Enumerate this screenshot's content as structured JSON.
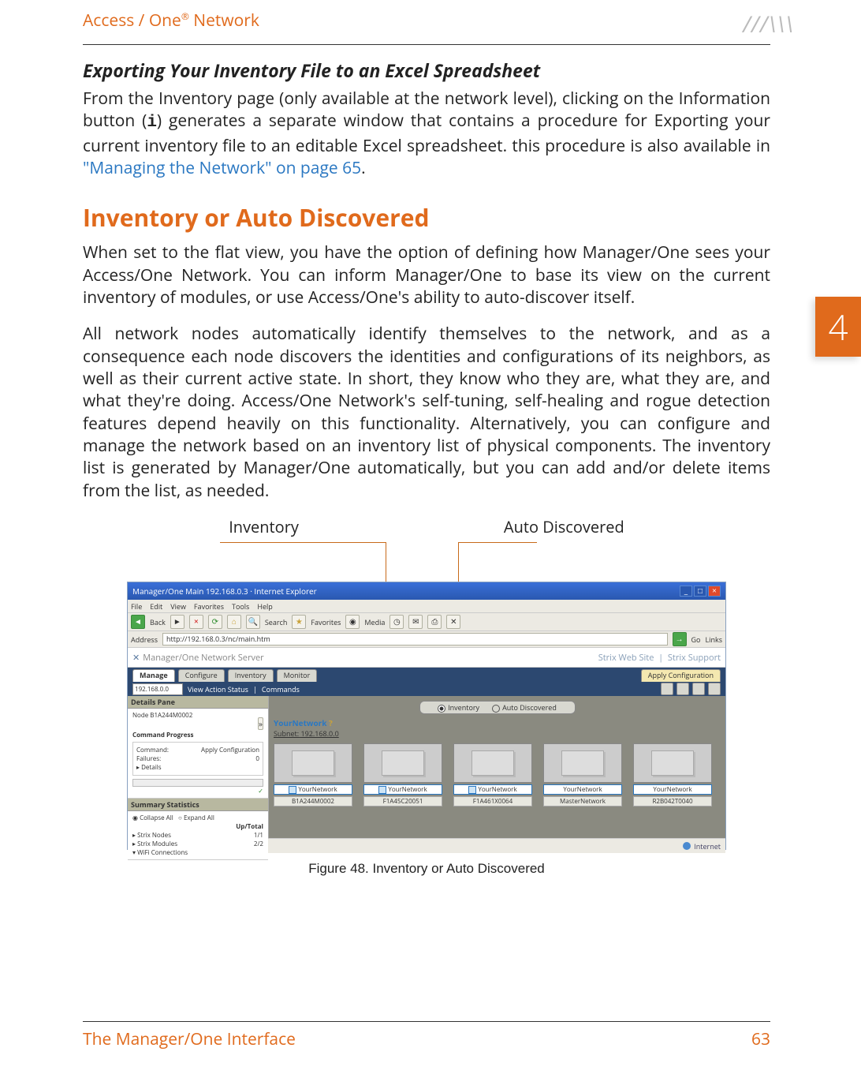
{
  "header": {
    "product": "Access / One",
    "reg": "®",
    "suffix": " Network",
    "logo": "///\\\\\\"
  },
  "side_tab": "4",
  "subsection": {
    "title": "Exporting Your Inventory File to an Excel Spreadsheet",
    "p1a": "From the Inventory page (only available at the network level), clicking on the Information button (",
    "p1_mono": "i",
    "p1b": ") generates a separate window that contains a procedure for Exporting your current inventory file to an editable Excel spreadsheet. this procedure is also available in ",
    "p1_link": "\"Managing the Network\" on page 65",
    "p1c": "."
  },
  "section": {
    "title": "Inventory or Auto Discovered",
    "p1": "When set to the flat view, you have the option of defining how Manager/One sees your Access/One Network. You can inform Manager/One to base its view on the current inventory of modules, or use Access/One's ability to auto-discover itself.",
    "p2": "All network nodes automatically identify themselves to the network, and as a consequence each node discovers the identities and configurations of its neighbors, as well as their current active state. In short, they know who they are, what they are, and what they're doing. Access/One Network's self-tuning, self-healing and rogue detection features depend heavily on this functionality. Alternatively, you can configure and manage the network based on an inventory list of physical components. The inventory list is generated by Manager/One automatically, but you can add and/or delete items from the list, as needed."
  },
  "callouts": {
    "left": "Inventory",
    "right": "Auto Discovered"
  },
  "screenshot": {
    "window_title": "Manager/One Main 192.168.0.3 · Internet Explorer",
    "menubar": [
      "File",
      "Edit",
      "View",
      "Favorites",
      "Tools",
      "Help"
    ],
    "toolbar": {
      "back": "Back",
      "search": "Search",
      "favorites": "Favorites",
      "media": "Media"
    },
    "addressbar": {
      "label": "Address",
      "url": "http://192.168.0.3/nc/main.htm",
      "go": "Go",
      "links": "Links"
    },
    "brandbar": {
      "title": "Manager/One Network Server",
      "link1": "Strix Web Site",
      "link2": "Strix Support"
    },
    "tabs": [
      "Manage",
      "Configure",
      "Inventory",
      "Monitor"
    ],
    "apply_btn": "Apply Configuration",
    "actionbar": {
      "ip": "192.168.0.0",
      "view_status": "View Action Status",
      "commands": "Commands"
    },
    "details_pane": {
      "header": "Details Pane",
      "node": "Node B1A244M0002",
      "progress_header": "Command Progress",
      "command_label": "Command:",
      "command_value": "Apply Configuration",
      "failures_label": "Failures:",
      "failures_value": "0",
      "details_label": "Details",
      "summary_header": "Summary Statistics",
      "collapse": "Collapse All",
      "expand": "Expand All",
      "col_up_total": "Up/Total",
      "rows": [
        {
          "label": "Strix Nodes",
          "value": "1/1"
        },
        {
          "label": "Strix Modules",
          "value": "2/2"
        },
        {
          "label": "WiFi Connections",
          "value": ""
        }
      ]
    },
    "right_pane": {
      "radio_inventory": "Inventory",
      "radio_auto": "Auto Discovered",
      "network_name": "YourNetwork",
      "subnet_label": "Subnet:",
      "subnet_value": "192.168.0.0",
      "nodes": [
        {
          "name": "YourNetwork",
          "id": "B1A244M0002"
        },
        {
          "name": "YourNetwork",
          "id": "F1A45C20051"
        },
        {
          "name": "YourNetwork",
          "id": "F1A461X0064"
        },
        {
          "name": "YourNetwork",
          "id": "MasterNetwork"
        },
        {
          "name": "YourNetwork",
          "id": "R2B042T0040"
        }
      ]
    },
    "statusbar": {
      "zone": "Internet"
    }
  },
  "figure_caption": "Figure 48. Inventory or Auto Discovered",
  "footer": {
    "left": "The Manager/One Interface",
    "page": "63"
  }
}
